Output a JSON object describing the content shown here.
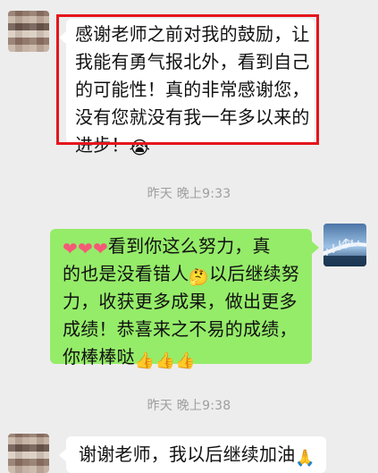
{
  "messages": [
    {
      "lines": [
        "感谢老师之前对我的鼓励，让",
        "我能有勇气报北外，看到自己",
        "的可能性！真的非常感谢您，",
        "没有您就没有我一年多以来的",
        "进步！"
      ],
      "emoji": "😭"
    },
    {
      "lines": [
        "看到你这么努力，真",
        "的也是没看错人",
        "以后继续努",
        "力，收获更多成果，做出更多",
        "成绩！恭喜来之不易的成绩，",
        "你棒棒哒"
      ],
      "hearts": [
        "❤",
        "❤",
        "❤"
      ],
      "thinking_emoji": "🤔",
      "thumbs": [
        "👍",
        "👍",
        "👍"
      ]
    },
    {
      "text": "谢谢老师，我以后继续加油",
      "emoji": "🙏"
    }
  ],
  "timestamps": {
    "first": "昨天 晚上9:33",
    "second": "昨天 晚上9:38"
  },
  "colors": {
    "background": "#ededed",
    "received_bubble": "#ffffff",
    "sent_bubble": "#95ec69",
    "highlight_border": "#e5151c",
    "timestamp": "#9e9e9e"
  }
}
